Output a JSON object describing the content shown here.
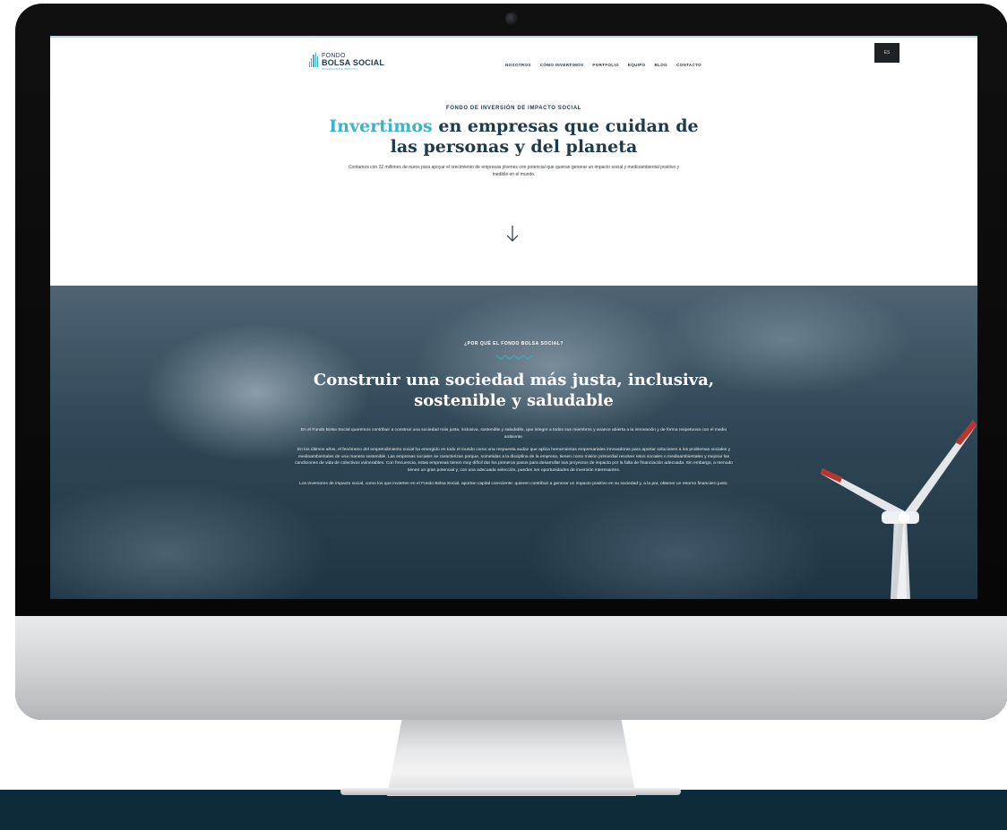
{
  "brand": {
    "logo_line1": "FONDO",
    "logo_line2": "BOLSA SOCIAL",
    "logo_tagline": "INVERSIÓN DE IMPACTO"
  },
  "nav": {
    "items": [
      "NOSOTROS",
      "CÓMO INVERTIMOS",
      "PORTFOLIO",
      "EQUIPO",
      "BLOG",
      "CONTACTO"
    ],
    "language": "ES"
  },
  "hero": {
    "eyebrow": "FONDO DE INVERSIÓN DE IMPACTO SOCIAL",
    "title_accent": "Invertimos",
    "title_line1_rest": " en empresas que cuidan de",
    "title_line2": "las personas y del planeta",
    "lead": "Contamos con 22 millones de euros para apoyar el crecimiento de empresas jóvenes con potencial que quieran generar un impacto social y medioambiental positivo y medible en el mundo.",
    "scroll_icon": "arrow-down-icon"
  },
  "why": {
    "eyebrow": "¿POR QUÉ EL FONDO BOLSA SOCIAL?",
    "title_line1": "Construir una sociedad más justa, inclusiva,",
    "title_line2": "sostenible y saludable",
    "paragraphs": [
      "En el Fondo Bolsa Social queremos contribuir a construir una sociedad más justa, inclusiva, sostenible y saludable, que integre a todos sus miembros y avance abierta a la innovación y de forma respetuosa con el medio ambiente.",
      "En los últimos años, el fenómeno del emprendimiento social ha emergido en todo el mundo como una respuesta audaz que aplica herramientas empresariales innovadoras para aportar soluciones a los problemas sociales y medioambientales de una manera sostenible. Las empresas sociales se caracterizan porque, sometidas a la disciplina de la empresa, tienen como misión primordial resolver retos sociales o medioambientales y mejorar las condiciones de vida de colectivos vulnerables. Con frecuencia, estas empresas tienen muy difícil dar los primeros pasos para desarrollar sus proyectos de impacto por la falta de financiación adecuada. Sin embargo, a menudo tienen un gran potencial y, con una adecuada selección, pueden ser oportunidades de inversión interesantes.",
      "Los inversores de impacto social, como los que invierten en el Fondo Bolsa Social, aportan capital consciente: quieren contribuir a generar un impacto positivo en su sociedad y, a la par, obtener un retorno financiero justo."
    ]
  },
  "colors": {
    "accent": "#3fb1c8",
    "navy": "#1c3b4b",
    "floor": "#0d2c3b"
  }
}
